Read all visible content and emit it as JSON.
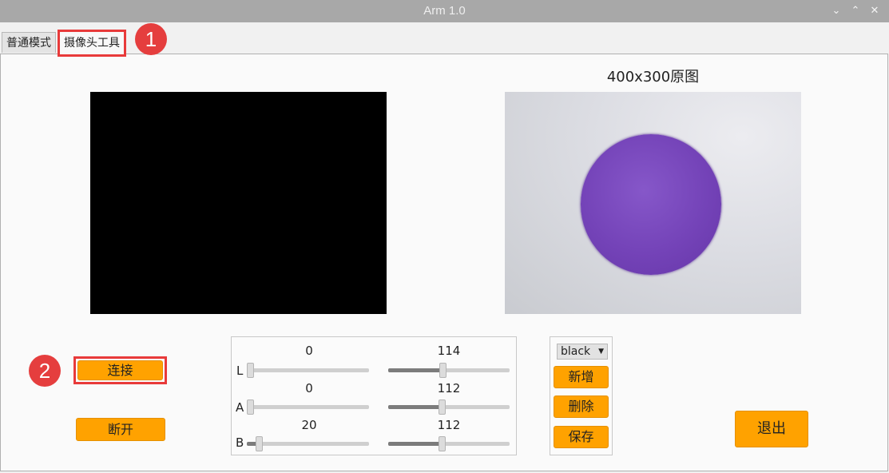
{
  "window": {
    "title": "Arm 1.0",
    "controls": [
      "⌄",
      "⌃",
      "✕"
    ]
  },
  "tabs": [
    {
      "label": "普通模式",
      "active": false
    },
    {
      "label": "摄像头工具",
      "active": true
    }
  ],
  "markers": {
    "one": "1",
    "two": "2"
  },
  "preview": {
    "raw_title": "400x300原图"
  },
  "buttons": {
    "connect": "连接",
    "disconnect": "断开",
    "quit": "退出"
  },
  "sliders": {
    "rows": [
      {
        "label": "L",
        "min": {
          "value": "0",
          "pos": 0.0
        },
        "max": {
          "value": "114",
          "pos": 0.447
        }
      },
      {
        "label": "A",
        "min": {
          "value": "0",
          "pos": 0.0
        },
        "max": {
          "value": "112",
          "pos": 0.439
        }
      },
      {
        "label": "B",
        "min": {
          "value": "20",
          "pos": 0.078
        },
        "max": {
          "value": "112",
          "pos": 0.439
        }
      }
    ]
  },
  "color_panel": {
    "selected": "black",
    "add": "新增",
    "delete": "删除",
    "save": "保存"
  },
  "colors": {
    "accent": "#ffa200",
    "highlight": "#e83a3a"
  }
}
